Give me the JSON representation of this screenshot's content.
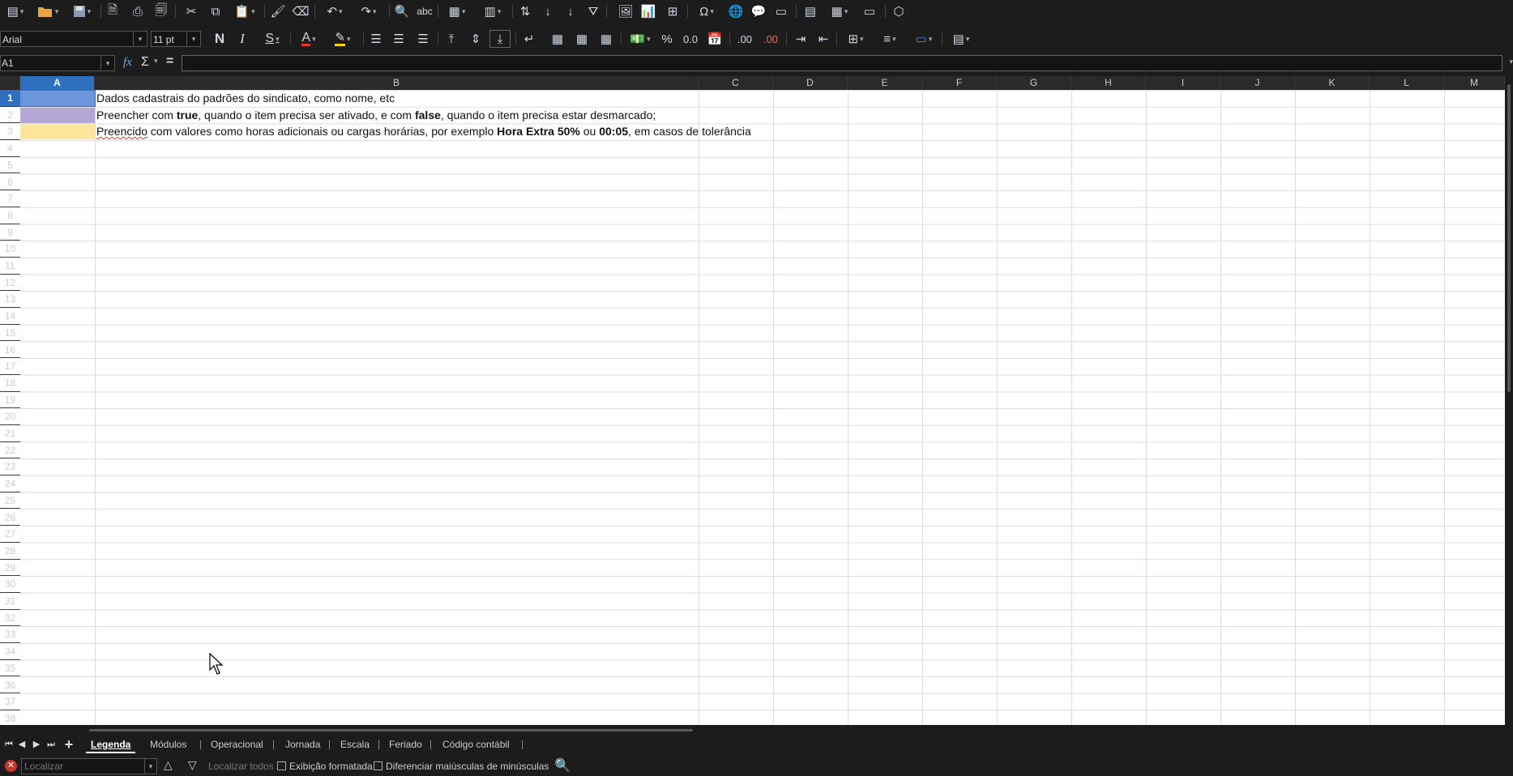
{
  "toolbar2": {
    "font_name": "Arial",
    "font_size": "11 pt",
    "bold_label": "N",
    "italic_label": "I",
    "strike_label": "S",
    "font_color_label": "A",
    "percent_label": "%",
    "number_label": "0.0",
    "add_decimal_label": ".00",
    "del_decimal_label": ".00"
  },
  "formula_bar": {
    "cell_ref": "A1",
    "fx_label": "fx",
    "sum_label": "Σ",
    "equals_label": "=",
    "content": ""
  },
  "sheet": {
    "columns": [
      "A",
      "B",
      "C",
      "D",
      "E",
      "F",
      "G",
      "H",
      "I",
      "J",
      "K",
      "L",
      "M"
    ],
    "active_column": "A",
    "active_row": 1,
    "rows": [
      "1",
      "2",
      "3",
      "4",
      "5",
      "6",
      "7",
      "8",
      "9",
      "10",
      "11",
      "12",
      "13",
      "14",
      "15",
      "16",
      "17",
      "18",
      "19",
      "20",
      "21",
      "22",
      "23",
      "24",
      "25",
      "26",
      "27",
      "28",
      "29",
      "30",
      "31",
      "32",
      "33",
      "34",
      "35",
      "36",
      "37",
      "38"
    ],
    "row1": {
      "swatch_color": "#6b95dc",
      "text": "Dados cadastrais do padrões do sindicato, como nome, etc"
    },
    "row2": {
      "swatch_color": "#b4a7d6",
      "t1": "Preencher com ",
      "b1": "true",
      "t2": ", quando o item precisa ser ativado, e com ",
      "b2": "false",
      "t3": ", quando o item precisa estar desmarcado;"
    },
    "row3": {
      "swatch_color": "#ffe599",
      "t0": "Preencido",
      "t1": " com valores como horas adicionais ou cargas horárias, por exemplo ",
      "b1": "Hora Extra 50%",
      "t2": " ou ",
      "b2": "00:05",
      "t3": ", em casos de tolerância"
    }
  },
  "tabs": {
    "add_label": "+",
    "items": [
      "Legenda",
      "Módulos",
      "Operacional",
      "Jornada",
      "Escala",
      "Feriado",
      "Código contábil"
    ],
    "active": "Legenda"
  },
  "findbar": {
    "placeholder": "Localizar",
    "find_all": "Localizar todos",
    "formatted": "Exibição formatada",
    "match_case": "Diferenciar maiúsculas de minúsculas"
  }
}
